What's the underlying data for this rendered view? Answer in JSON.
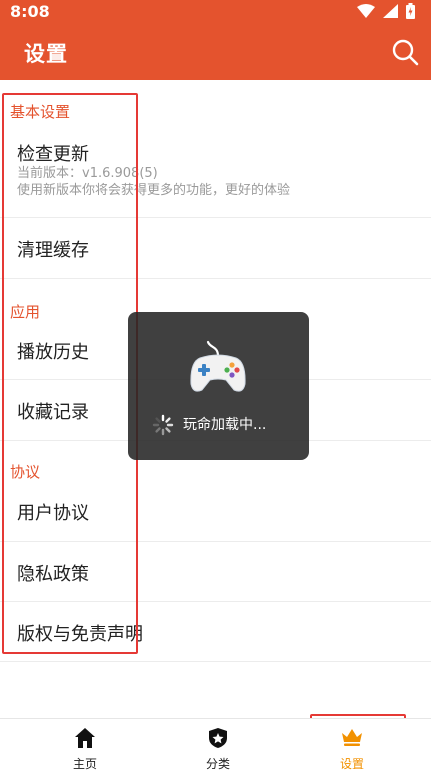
{
  "status_bar": {
    "time": "8:08"
  },
  "app_bar": {
    "title": "设置"
  },
  "sections": {
    "basic": {
      "header": "基本设置",
      "check_update": {
        "label": "检查更新",
        "version": "当前版本：v1.6.908(5)",
        "hint": "使用新版本你将会获得更多的功能，更好的体验"
      },
      "clear_cache": {
        "label": "清理缓存"
      }
    },
    "app": {
      "header": "应用",
      "history": {
        "label": "播放历史"
      },
      "favorites": {
        "label": "收藏记录"
      }
    },
    "agreement": {
      "header": "协议",
      "user_agreement": {
        "label": "用户协议"
      },
      "privacy_policy": {
        "label": "隐私政策"
      },
      "copyright": {
        "label": "版权与免责声明"
      }
    }
  },
  "loading_toast": {
    "text": "玩命加载中..."
  },
  "bottom_nav": {
    "tabs": [
      {
        "label": "主页",
        "icon": "home-icon",
        "active": false
      },
      {
        "label": "分类",
        "icon": "star-badge-icon",
        "active": false
      },
      {
        "label": "设置",
        "icon": "crown-icon",
        "active": true
      }
    ]
  },
  "colors": {
    "primary": "#e4532e",
    "active_tab": "#f29100",
    "highlight": "#e53935"
  }
}
